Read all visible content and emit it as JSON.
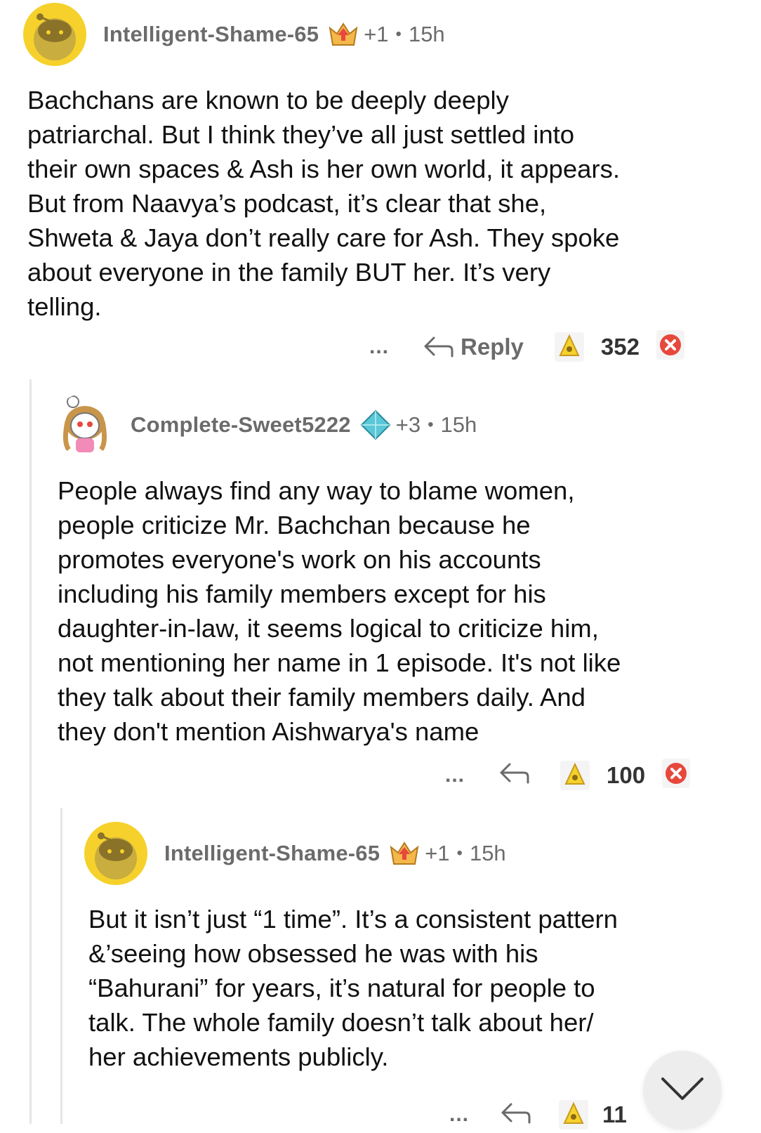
{
  "comments": [
    {
      "username": "Intelligent-Shame-65",
      "plus": "+1",
      "age": "15h",
      "text": "Bachchans are known to be deeply deeply\npatriarchal. But I think they’ve all just settled into\ntheir own spaces & Ash is her own world, it appears.\nBut from Naavya’s podcast, it’s clear that she,\nShweta & Jaya don’t really care for Ash. They spoke\nabout everyone in the family BUT her. It’s very\ntelling.",
      "more": "...",
      "reply_label": "Reply",
      "votes": "352"
    },
    {
      "username": "Complete-Sweet5222",
      "plus": "+3",
      "age": "15h",
      "text": "People always find any way to blame women,\npeople criticize Mr. Bachchan because he\npromotes everyone's work on his accounts\nincluding his family members except for his\ndaughter-in-law, it seems logical to criticize him,\nnot mentioning her name in 1 episode. It's not like\nthey talk about their family members daily. And\nthey don't mention Aishwarya's name",
      "more": "...",
      "votes": "100"
    },
    {
      "username": "Intelligent-Shame-65",
      "plus": "+1",
      "age": "15h",
      "text": "But it isn’t just “1 time”. It’s a consistent pattern\n&’seeing how obsessed he was with his\n“Bahurani” for years, it’s natural for people to\ntalk. The whole family doesn’t talk about her/\nher achievements publicly.",
      "more": "...",
      "votes": "11"
    }
  ],
  "separator": "•",
  "icons": {
    "avatar": "reddit-snoo-avatar",
    "badge_1": "crown-upvote-badge",
    "badge_2": "diamond-badge",
    "reply": "reply-arrow-icon",
    "award": "award-icon",
    "close": "close-x-icon",
    "scroll": "chevron-down-icon"
  },
  "colors": {
    "avatar_bg": "#f6d12b",
    "close_badge": "#e8483c",
    "muted_text": "#6b6b6b"
  }
}
